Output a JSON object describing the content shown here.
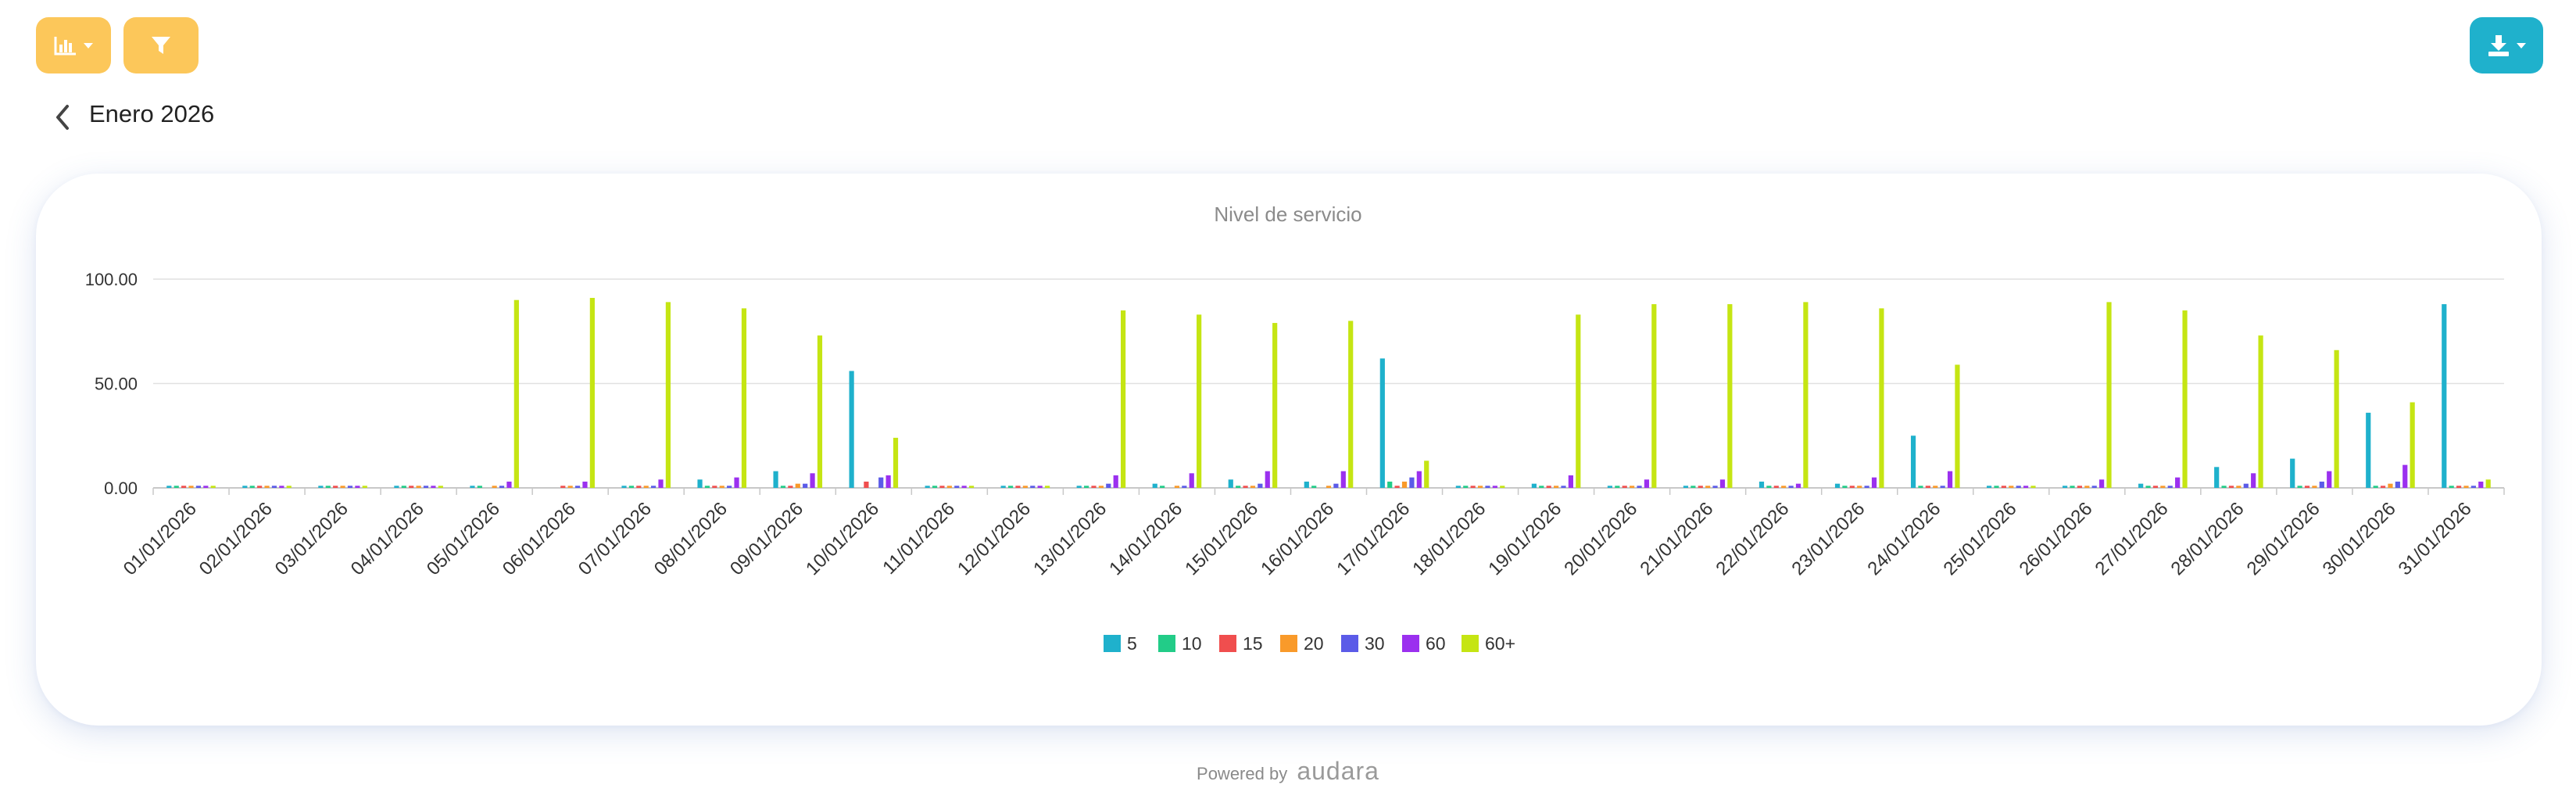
{
  "toolbar": {
    "chart_type_icon": "bar-chart-icon",
    "filter_icon": "filter-icon",
    "download_icon": "download-icon",
    "colors": {
      "yellow": "#fcc75a",
      "cyan": "#1fb1cc"
    }
  },
  "header": {
    "title": "Enero 2026",
    "back_icon": "chevron-left-icon"
  },
  "footer": {
    "powered_label": "Powered by",
    "brand": "audara"
  },
  "chart_data": {
    "type": "bar",
    "title": "Nivel de servicio",
    "ylim": [
      0,
      100
    ],
    "yticks": [
      "100.00",
      "50.00",
      "0.00"
    ],
    "grid": true,
    "legend_position": "bottom",
    "categories": [
      "01/01/2026",
      "02/01/2026",
      "03/01/2026",
      "04/01/2026",
      "05/01/2026",
      "06/01/2026",
      "07/01/2026",
      "08/01/2026",
      "09/01/2026",
      "10/01/2026",
      "11/01/2026",
      "12/01/2026",
      "13/01/2026",
      "14/01/2026",
      "15/01/2026",
      "16/01/2026",
      "17/01/2026",
      "18/01/2026",
      "19/01/2026",
      "20/01/2026",
      "21/01/2026",
      "22/01/2026",
      "23/01/2026",
      "24/01/2026",
      "25/01/2026",
      "26/01/2026",
      "27/01/2026",
      "28/01/2026",
      "29/01/2026",
      "30/01/2026",
      "31/01/2026"
    ],
    "series": [
      {
        "name": "5",
        "color": "#1fb1cc",
        "values": [
          1,
          1,
          1,
          1,
          1,
          0,
          1,
          4,
          8,
          56,
          1,
          1,
          1,
          2,
          4,
          3,
          62,
          1,
          2,
          1,
          1,
          3,
          2,
          25,
          1,
          1,
          2,
          10,
          14,
          36,
          88
        ]
      },
      {
        "name": "10",
        "color": "#22cc88",
        "values": [
          1,
          1,
          1,
          1,
          1,
          0,
          1,
          1,
          1,
          0,
          1,
          1,
          1,
          1,
          1,
          1,
          3,
          1,
          1,
          1,
          1,
          1,
          1,
          1,
          1,
          1,
          1,
          1,
          1,
          1,
          1
        ]
      },
      {
        "name": "15",
        "color": "#f04e4e",
        "values": [
          1,
          1,
          1,
          1,
          0,
          1,
          1,
          1,
          1,
          3,
          1,
          1,
          1,
          0,
          1,
          0,
          1,
          1,
          1,
          1,
          1,
          1,
          1,
          1,
          1,
          1,
          1,
          1,
          1,
          1,
          1
        ]
      },
      {
        "name": "20",
        "color": "#f99a2a",
        "values": [
          1,
          1,
          1,
          1,
          1,
          1,
          1,
          1,
          2,
          0,
          1,
          1,
          1,
          1,
          1,
          1,
          3,
          1,
          1,
          1,
          1,
          1,
          1,
          1,
          1,
          1,
          1,
          1,
          1,
          2,
          1
        ]
      },
      {
        "name": "30",
        "color": "#5b5be8",
        "values": [
          1,
          1,
          1,
          1,
          1,
          1,
          1,
          1,
          2,
          5,
          1,
          1,
          2,
          1,
          2,
          2,
          5,
          1,
          1,
          1,
          1,
          1,
          1,
          1,
          1,
          1,
          1,
          2,
          3,
          3,
          1
        ]
      },
      {
        "name": "60",
        "color": "#9b30ef",
        "values": [
          1,
          1,
          1,
          1,
          3,
          3,
          4,
          5,
          7,
          6,
          1,
          1,
          6,
          7,
          8,
          8,
          8,
          1,
          6,
          4,
          4,
          2,
          5,
          8,
          1,
          4,
          5,
          7,
          8,
          11,
          3
        ]
      },
      {
        "name": "60+",
        "color": "#c5e513",
        "values": [
          1,
          1,
          1,
          1,
          90,
          91,
          89,
          86,
          73,
          24,
          1,
          1,
          85,
          83,
          79,
          80,
          13,
          1,
          83,
          88,
          88,
          89,
          86,
          59,
          1,
          89,
          85,
          73,
          66,
          41,
          4
        ]
      }
    ]
  }
}
